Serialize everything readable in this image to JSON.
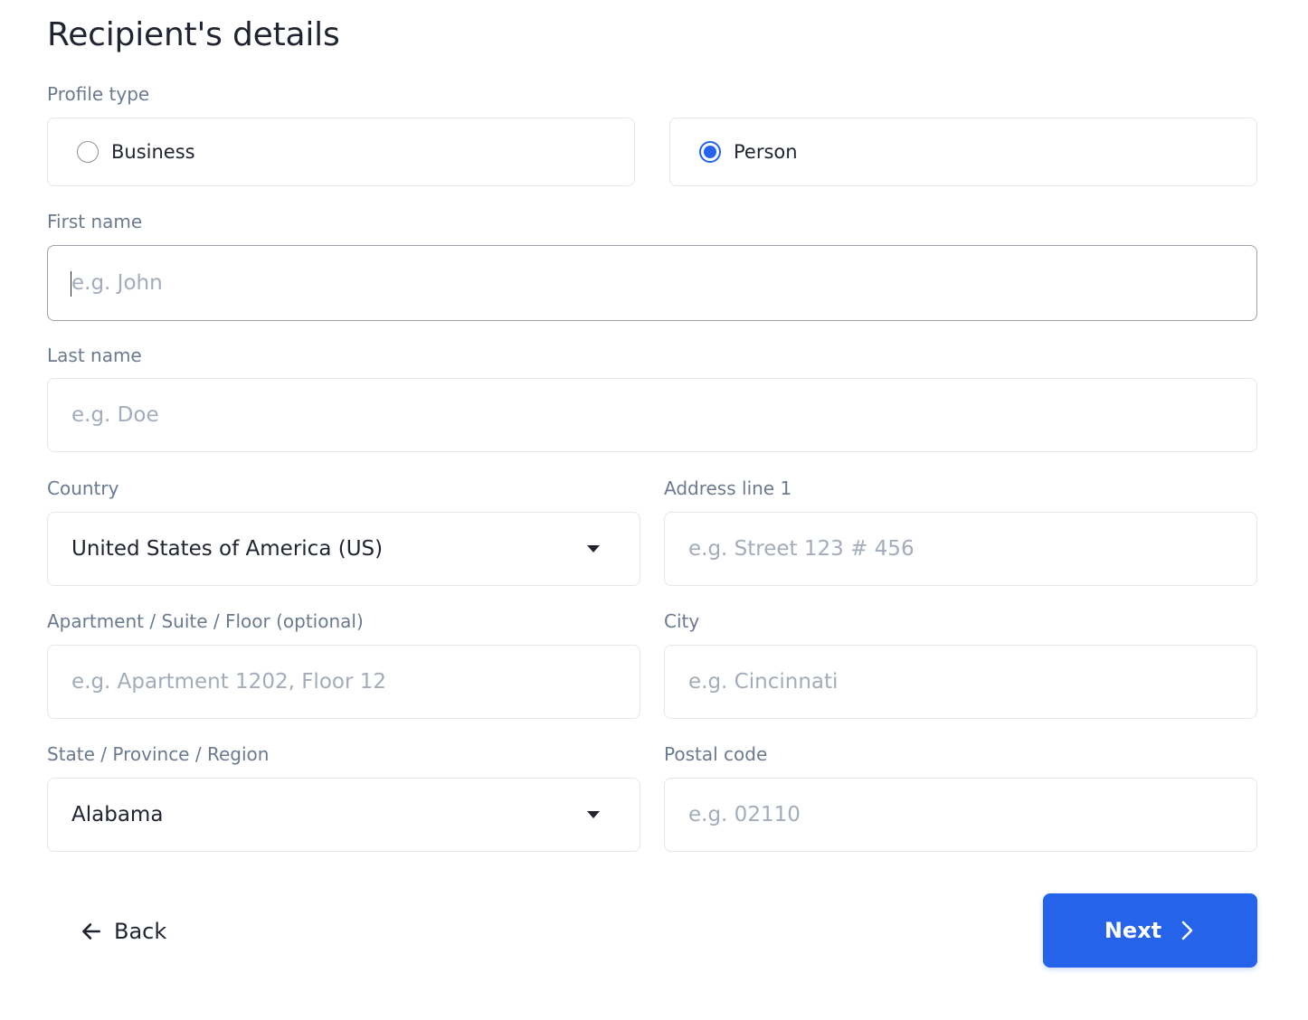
{
  "title": "Recipient's details",
  "profile_type": {
    "label": "Profile type",
    "options": [
      {
        "label": "Business",
        "selected": false
      },
      {
        "label": "Person",
        "selected": true
      }
    ]
  },
  "first_name": {
    "label": "First name",
    "placeholder": "e.g. John",
    "value": ""
  },
  "last_name": {
    "label": "Last name",
    "placeholder": "e.g. Doe",
    "value": ""
  },
  "country": {
    "label": "Country",
    "value": "United States of America (US)"
  },
  "address_line_1": {
    "label": "Address line 1",
    "placeholder": "e.g. Street 123 # 456",
    "value": ""
  },
  "apartment": {
    "label": "Apartment / Suite / Floor (optional)",
    "placeholder": "e.g. Apartment 1202, Floor 12",
    "value": ""
  },
  "city": {
    "label": "City",
    "placeholder": "e.g. Cincinnati",
    "value": ""
  },
  "state": {
    "label": "State / Province / Region",
    "value": "Alabama"
  },
  "postal_code": {
    "label": "Postal code",
    "placeholder": "e.g. 02110",
    "value": ""
  },
  "actions": {
    "back_label": "Back",
    "next_label": "Next"
  },
  "colors": {
    "accent": "#2563eb",
    "label": "#6b7a90",
    "placeholder": "#a3acba",
    "border": "#e4e7ec"
  },
  "icons": {
    "back": "arrow-left-icon",
    "next": "chevron-right-icon",
    "select": "caret-down-icon"
  }
}
